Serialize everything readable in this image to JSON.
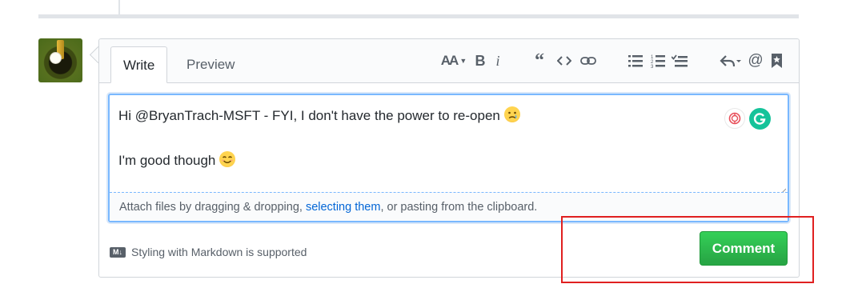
{
  "tabs": {
    "write": "Write",
    "preview": "Preview"
  },
  "toolbar": [
    "text-size-icon",
    "bold-icon",
    "italic-icon",
    "quote-icon",
    "code-icon",
    "link-icon",
    "bulleted-list-icon",
    "numbered-list-icon",
    "task-list-icon",
    "reply-icon",
    "mention-icon",
    "bookmark-icon"
  ],
  "editor": {
    "line1": "Hi @BryanTrach-MSFT - FYI, I don't have the power to re-open ",
    "line2": "I'm good though "
  },
  "attach": {
    "prefix": "Attach files by dragging & dropping, ",
    "link": "selecting them",
    "suffix": ", or pasting from the clipboard."
  },
  "markdown_note": "Styling with Markdown is supported",
  "markdown_badge": "M↓",
  "comment_button": "Comment",
  "colors": {
    "accent": "#28a745",
    "link": "#0366d6",
    "highlight": "#e02020",
    "focus": "#79b8ff"
  }
}
